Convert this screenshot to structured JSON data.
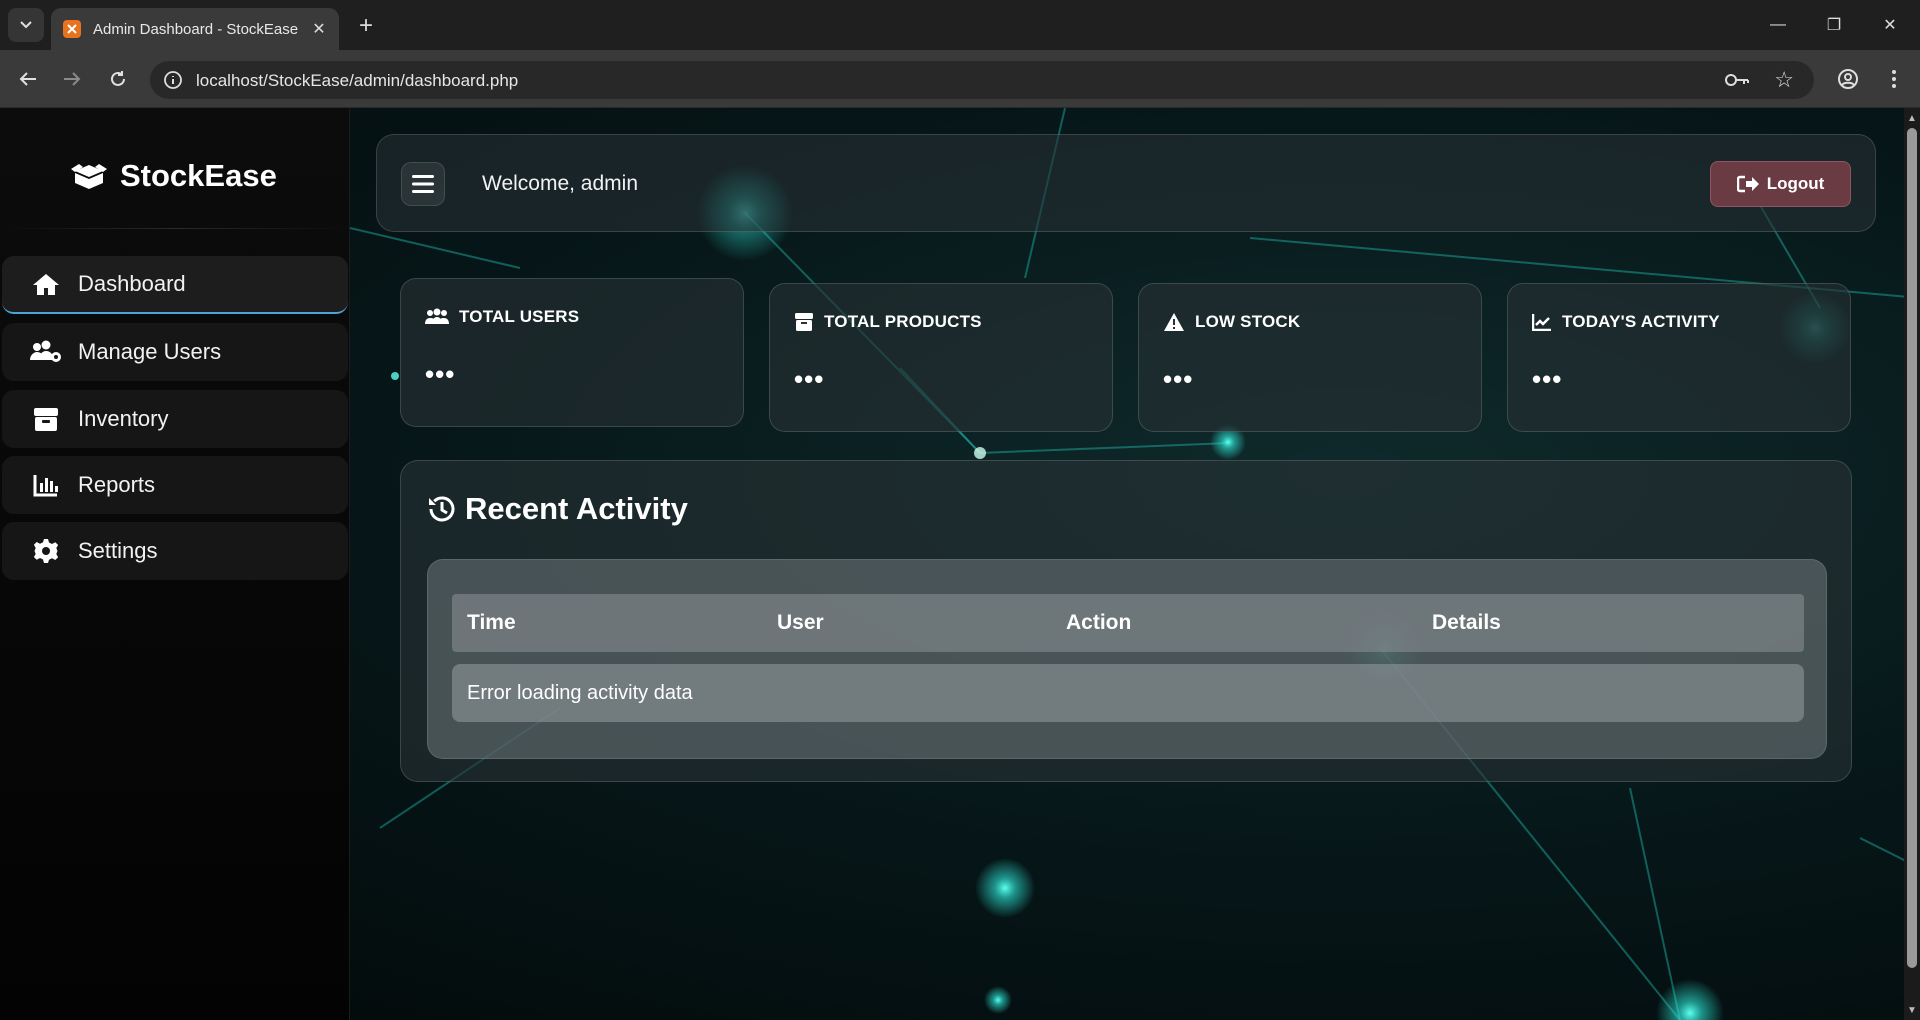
{
  "browser": {
    "tab_title": "Admin Dashboard - StockEase",
    "url": "localhost/StockEase/admin/dashboard.php",
    "controls": {
      "minimize": "—",
      "restore": "❐",
      "close": "✕"
    }
  },
  "sidebar": {
    "brand": "StockEase",
    "items": [
      {
        "label": "Dashboard",
        "icon": "home-icon"
      },
      {
        "label": "Manage Users",
        "icon": "users-gear-icon"
      },
      {
        "label": "Inventory",
        "icon": "box-icon"
      },
      {
        "label": "Reports",
        "icon": "chart-bar-icon"
      },
      {
        "label": "Settings",
        "icon": "gear-icon"
      }
    ]
  },
  "topbar": {
    "welcome": "Welcome, admin",
    "logout_label": "Logout"
  },
  "cards": [
    {
      "title": "TOTAL USERS",
      "value": "•••",
      "icon": "users-icon"
    },
    {
      "title": "TOTAL PRODUCTS",
      "value": "•••",
      "icon": "box-icon"
    },
    {
      "title": "LOW STOCK",
      "value": "•••",
      "icon": "warning-icon"
    },
    {
      "title": "TODAY'S ACTIVITY",
      "value": "•••",
      "icon": "line-chart-icon"
    }
  ],
  "activity": {
    "title": "Recent Activity",
    "columns": [
      "Time",
      "User",
      "Action",
      "Details"
    ],
    "message": "Error loading activity data"
  },
  "colors": {
    "accent": "#4fa3d8",
    "logout": "#6b3b44",
    "glow": "#2ee6d6"
  }
}
